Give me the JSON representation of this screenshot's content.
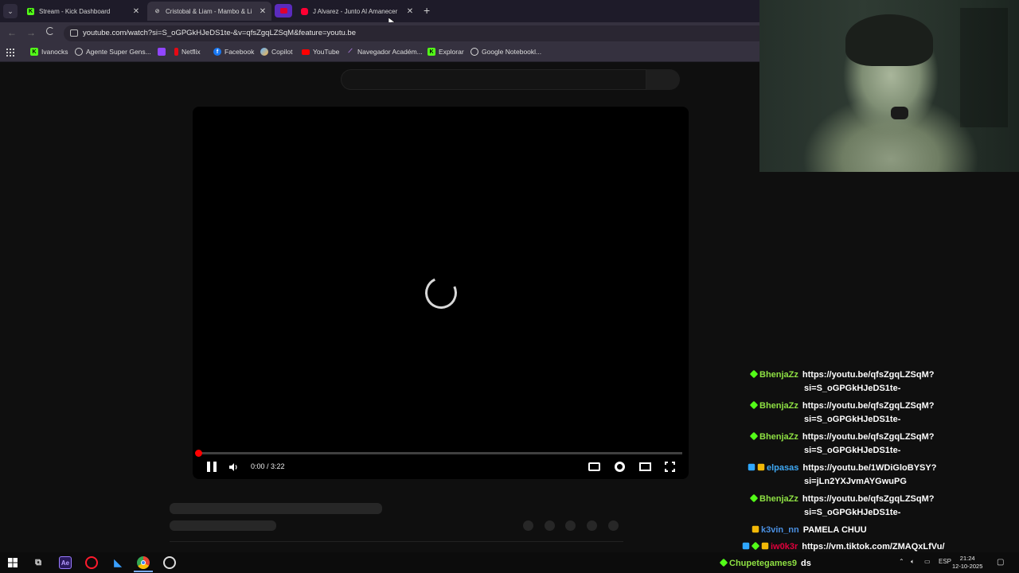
{
  "browser": {
    "tabs": [
      {
        "title": "Stream - Kick Dashboard",
        "favicon": "kick-icon",
        "active": false
      },
      {
        "title": "Cristobal & Liam - Mambo & Li",
        "favicon": "link-icon",
        "active": true
      },
      {
        "title": "J Alvarez - Junto Al Amanecer",
        "favicon": "youtube-icon",
        "active": false
      }
    ],
    "url": "youtube.com/watch?si=S_oGPGkHJeDS1te-&v=qfsZgqLZSqM&feature=youtu.be",
    "bookmarks": [
      {
        "label": "Ivanocks",
        "icon": "kick-icon",
        "color": "#53fc18"
      },
      {
        "label": "Agente Super Gens...",
        "icon": "agent-icon",
        "color": "#cfcfcf"
      },
      {
        "label": "",
        "icon": "twitch-icon",
        "color": "#9146ff"
      },
      {
        "label": "Netflix",
        "icon": "netflix-icon",
        "color": "#e50914"
      },
      {
        "label": "Facebook",
        "icon": "facebook-icon",
        "color": "#1877f2"
      },
      {
        "label": "Copilot",
        "icon": "copilot-icon",
        "color": "#5fb0ff"
      },
      {
        "label": "YouTube",
        "icon": "youtube-icon",
        "color": "#ff0000"
      },
      {
        "label": "Navegador Académ...",
        "icon": "scholar-icon",
        "color": "#c58cff"
      },
      {
        "label": "Explorar",
        "icon": "kick-icon",
        "color": "#53fc18"
      },
      {
        "label": "Google Notebookl...",
        "icon": "notebooklm-icon",
        "color": "#dddddd"
      }
    ]
  },
  "player": {
    "state": "loading",
    "time": "0:00 / 3:22",
    "progress": 0.0,
    "accent": "#ff0000"
  },
  "chat": [
    {
      "user": "BhenjaZz",
      "user_color": "#8ee043",
      "badges": [
        "green"
      ],
      "line1": "https://youtu.be/qfsZgqLZSqM?",
      "line2": "si=S_oGPGkHJeDS1te-"
    },
    {
      "user": "BhenjaZz",
      "user_color": "#8ee043",
      "badges": [
        "green"
      ],
      "line1": "https://youtu.be/qfsZgqLZSqM?",
      "line2": "si=S_oGPGkHJeDS1te-"
    },
    {
      "user": "BhenjaZz",
      "user_color": "#8ee043",
      "badges": [
        "green"
      ],
      "line1": "https://youtu.be/qfsZgqLZSqM?",
      "line2": "si=S_oGPGkHJeDS1te-"
    },
    {
      "user": "elpasas",
      "user_color": "#3fa9f5",
      "badges": [
        "blue",
        "gold"
      ],
      "line1": "https://youtu.be/1WDiGloBYSY?",
      "line2": "si=jLn2YXJvmAYGwuPG"
    },
    {
      "user": "BhenjaZz",
      "user_color": "#8ee043",
      "badges": [
        "green"
      ],
      "line1": "https://youtu.be/qfsZgqLZSqM?",
      "line2": "si=S_oGPGkHJeDS1te-"
    },
    {
      "user": "k3vin_nn",
      "user_color": "#4a90e2",
      "badges": [
        "gold"
      ],
      "line1": "PAMELA CHUU",
      "line2": ""
    },
    {
      "user": "iw0k3r",
      "user_color": "#e0003c",
      "badges": [
        "blue",
        "green",
        "gold"
      ],
      "line1": "https://vm.tiktok.com/ZMAQxLfVu/",
      "line2": ""
    },
    {
      "user": "Chupetegames9",
      "user_color": "#8ee043",
      "badges": [
        "green"
      ],
      "line1": "ds",
      "line2": ""
    }
  ],
  "taskbar": {
    "apps": [
      "windows-start-icon",
      "task-view-icon",
      "after-effects-icon",
      "opera-icon",
      "visual-studio-icon",
      "chrome-icon",
      "obs-icon"
    ],
    "language": "ESP",
    "time": "21:24",
    "date": "12-10-2025"
  }
}
